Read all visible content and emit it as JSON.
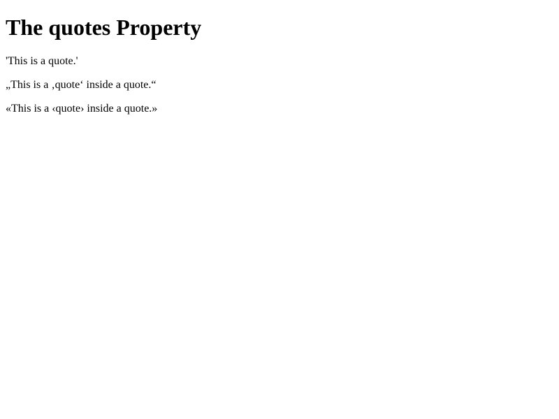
{
  "page": {
    "title": "The quotes Property",
    "quotes": [
      "'This is a quote.'",
      "„This is a ‚quote‘ inside a quote.“",
      "«This is a ‹quote› inside a quote.»"
    ]
  }
}
